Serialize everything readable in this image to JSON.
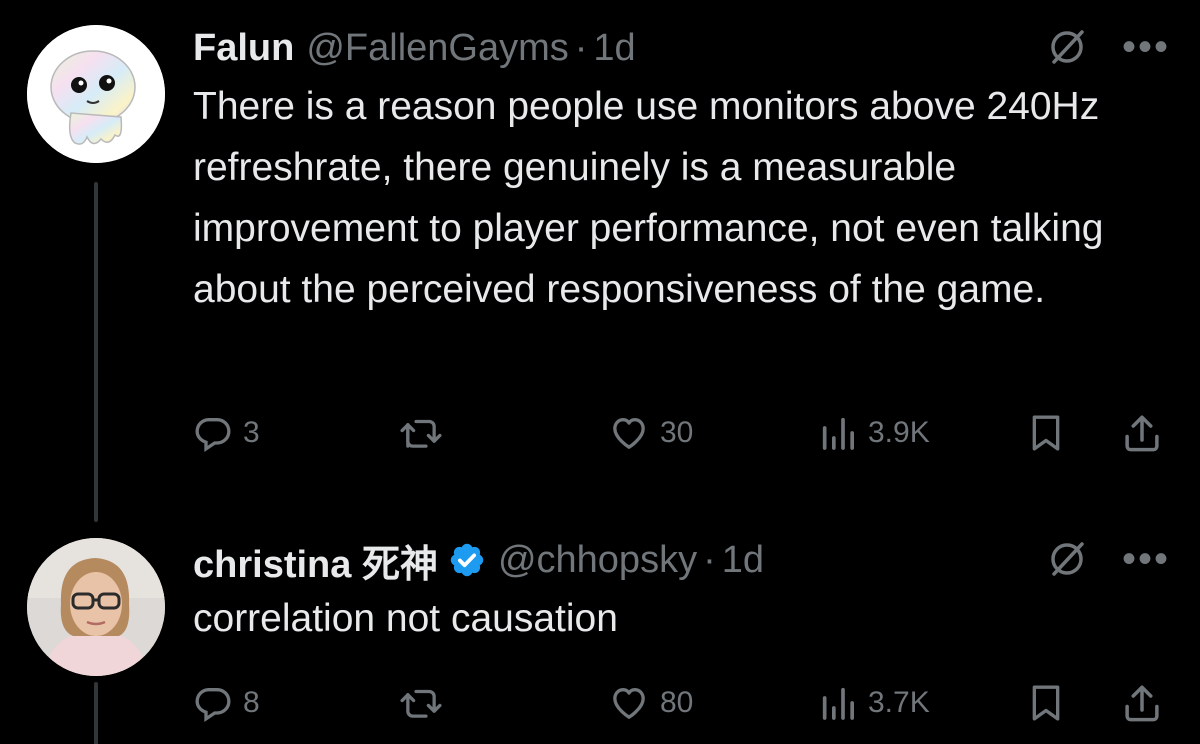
{
  "tweets": [
    {
      "display_name": "Falun",
      "verified": false,
      "handle": "@FallenGayms",
      "separator": "·",
      "time": "1d",
      "text": "There is a reason people use monitors above 240Hz refreshrate, there genuinely is a measurable improvement to player performance, not even talking about the perceived responsiveness of the game.",
      "replies": "3",
      "retweets": "",
      "likes": "30",
      "views": "3.9K"
    },
    {
      "display_name": "christina 死神",
      "verified": true,
      "handle": "@chhopsky",
      "separator": "·",
      "time": "1d",
      "text": "correlation not causation",
      "replies": "8",
      "retweets": "",
      "likes": "80",
      "views": "3.7K"
    }
  ],
  "icons": {
    "more": "•••",
    "reply": "reply-icon",
    "retweet": "retweet-icon",
    "like": "heart-icon",
    "views": "views-icon",
    "bookmark": "bookmark-icon",
    "share": "share-icon",
    "grok": "grok-icon"
  },
  "colors": {
    "background": "#000000",
    "text_primary": "#e7e9ea",
    "text_secondary": "#71767b",
    "verified_blue": "#1d9bf0"
  }
}
